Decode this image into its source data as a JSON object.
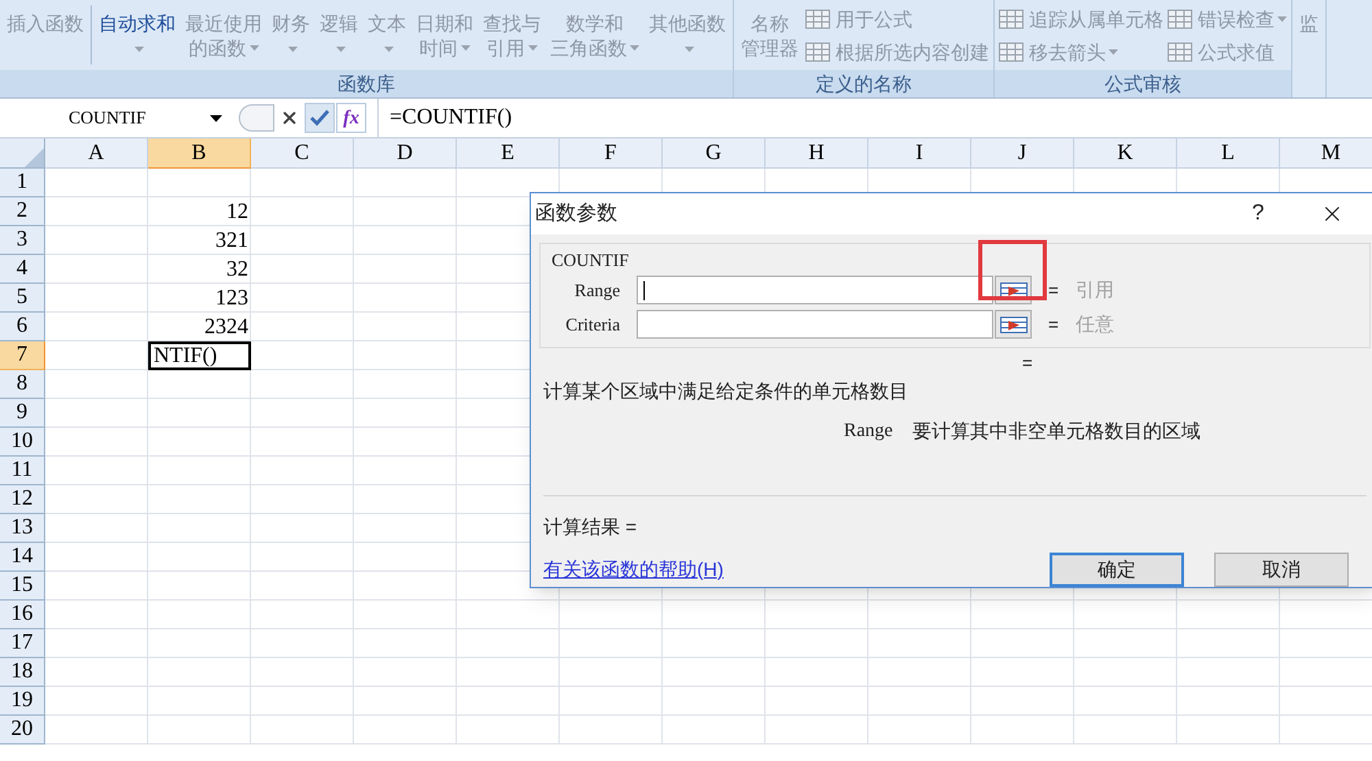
{
  "ribbon": {
    "groups": [
      {
        "label": "函数库",
        "items": [
          {
            "kind": "large",
            "lines": [
              "插入函数"
            ],
            "disabled": true,
            "dropdown": false
          },
          {
            "kind": "separator"
          },
          {
            "kind": "large",
            "lines": [
              "自动求和"
            ],
            "disabled": false,
            "dropdown": true
          },
          {
            "kind": "large",
            "lines": [
              "最近使用",
              "的函数"
            ],
            "disabled": true,
            "dropdown": true
          },
          {
            "kind": "large",
            "lines": [
              "财务"
            ],
            "disabled": true,
            "dropdown": true
          },
          {
            "kind": "large",
            "lines": [
              "逻辑"
            ],
            "disabled": true,
            "dropdown": true
          },
          {
            "kind": "large",
            "lines": [
              "文本"
            ],
            "disabled": true,
            "dropdown": true
          },
          {
            "kind": "large",
            "lines": [
              "日期和",
              "时间"
            ],
            "disabled": true,
            "dropdown": true
          },
          {
            "kind": "large",
            "lines": [
              "查找与",
              "引用"
            ],
            "disabled": true,
            "dropdown": true
          },
          {
            "kind": "large",
            "lines": [
              "数学和",
              "三角函数"
            ],
            "disabled": true,
            "dropdown": true
          },
          {
            "kind": "large",
            "lines": [
              "其他函数"
            ],
            "disabled": true,
            "dropdown": true
          }
        ]
      },
      {
        "label": "定义的名称",
        "items": [
          {
            "kind": "large",
            "lines": [
              "名称",
              "管理器"
            ],
            "disabled": true,
            "dropdown": false
          },
          {
            "kind": "small",
            "label": "用于公式",
            "disabled": true,
            "dropdown": false
          },
          {
            "kind": "small",
            "label": "根据所选内容创建",
            "disabled": true,
            "dropdown": false
          }
        ]
      },
      {
        "label": "公式审核",
        "items": [
          {
            "kind": "small",
            "label": "追踪从属单元格",
            "disabled": true,
            "dropdown": false
          },
          {
            "kind": "small",
            "label": "移去箭头",
            "disabled": true,
            "dropdown": true
          },
          {
            "kind": "small",
            "label": "错误检查",
            "disabled": true,
            "dropdown": true
          },
          {
            "kind": "small",
            "label": "公式求值",
            "disabled": true,
            "dropdown": false
          }
        ]
      },
      {
        "items": [
          {
            "kind": "large",
            "lines": [
              "监"
            ],
            "disabled": true,
            "dropdown": false
          }
        ]
      }
    ]
  },
  "formula_bar": {
    "name_box": "COUNTIF",
    "function_button": "fx",
    "formula": "=COUNTIF()"
  },
  "columns": [
    {
      "label": "A",
      "selected": false
    },
    {
      "label": "B",
      "selected": true
    },
    {
      "label": "C",
      "selected": false
    },
    {
      "label": "D",
      "selected": false
    },
    {
      "label": "E",
      "selected": false
    },
    {
      "label": "F",
      "selected": false
    },
    {
      "label": "G",
      "selected": false
    },
    {
      "label": "H",
      "selected": false
    },
    {
      "label": "I",
      "selected": false
    },
    {
      "label": "J",
      "selected": false
    },
    {
      "label": "K",
      "selected": false
    },
    {
      "label": "L",
      "selected": false
    },
    {
      "label": "M",
      "selected": false
    }
  ],
  "rows": [
    {
      "label": "1",
      "selected": false
    },
    {
      "label": "2",
      "selected": false,
      "column_b": "12"
    },
    {
      "label": "3",
      "selected": false,
      "column_b": "321"
    },
    {
      "label": "4",
      "selected": false,
      "column_b": "32"
    },
    {
      "label": "5",
      "selected": false,
      "column_b": "123"
    },
    {
      "label": "6",
      "selected": false,
      "column_b": "2324"
    },
    {
      "label": "7",
      "selected": true,
      "column_b": "NTIF()",
      "editing": true
    },
    {
      "label": "8",
      "selected": false
    },
    {
      "label": "9",
      "selected": false
    },
    {
      "label": "10",
      "selected": false
    },
    {
      "label": "11",
      "selected": false
    },
    {
      "label": "12",
      "selected": false
    },
    {
      "label": "13",
      "selected": false
    },
    {
      "label": "14",
      "selected": false
    },
    {
      "label": "15",
      "selected": false
    },
    {
      "label": "16",
      "selected": false
    },
    {
      "label": "17",
      "selected": false
    },
    {
      "label": "18",
      "selected": false
    },
    {
      "label": "19",
      "selected": false
    },
    {
      "label": "20",
      "selected": false
    }
  ],
  "dialog": {
    "title": "函数参数",
    "help": "?",
    "function_name": "COUNTIF",
    "arguments": [
      {
        "label": "Range",
        "focused": true,
        "highlighted": true,
        "equals": "=",
        "result": "引用"
      },
      {
        "label": "Criteria",
        "focused": false,
        "highlighted": false,
        "equals": "=",
        "result": "任意"
      }
    ],
    "equals": "=",
    "description": "计算某个区域中满足给定条件的单元格数目",
    "argument_help": {
      "name": "Range",
      "text": "要计算其中非空单元格数目的区域"
    },
    "result_label": "计算结果 =",
    "help_link": "有关该函数的帮助(H)",
    "buttons": [
      {
        "label": "确定",
        "default": true
      },
      {
        "label": "取消",
        "default": false
      }
    ]
  }
}
